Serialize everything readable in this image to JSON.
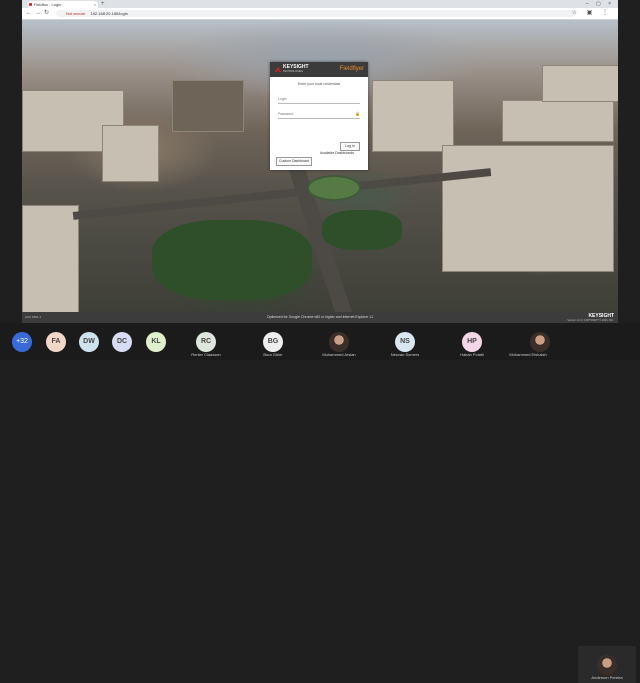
{
  "browser": {
    "tab_title": "Fieldfox - Login",
    "tab_close": "×",
    "new_tab": "+",
    "window_controls": "–  ▢  ×",
    "nav": {
      "back": "←",
      "forward": "→",
      "reload": "↻"
    },
    "security": "Not secure",
    "url": "192.168.20.185/login",
    "toolbar_icons": "☆ ▣ ⋮"
  },
  "login_card": {
    "brand": "KEYSIGHT",
    "brand_sub": "TECHNOLOGIES",
    "product": "Fieldflyer",
    "prompt": "Enter your local credentials",
    "login_placeholder": "Login",
    "password_placeholder": "Password",
    "login_button": "Log in",
    "available_dashboards": "Available Dashboards",
    "custom_dashboard_button": "Custom Dashboard"
  },
  "footer": {
    "left_text": "AUX 6891.1",
    "notice": "Optimized for Google Chrome v80 or higher and Internet Explorer 11",
    "brand": "KEYSIGHT",
    "copyright": "Version 1.0.1 | COPYRIGHT © 2021, INC."
  },
  "participants": {
    "more_count": "+32",
    "people": [
      {
        "initials": "FA",
        "name": "",
        "color": "#f2d7c8"
      },
      {
        "initials": "DW",
        "name": "",
        "color": "#cfe3ef"
      },
      {
        "initials": "DC",
        "name": "",
        "color": "#d8dcf3"
      },
      {
        "initials": "KL",
        "name": "",
        "color": "#dff0cf"
      },
      {
        "initials": "RC",
        "name": "Renier Claassen",
        "color": "#dfe6dd"
      },
      {
        "initials": "BG",
        "name": "Bora Güler",
        "color": "#eeeeee"
      },
      {
        "initials": "",
        "name": "Muhammed Arslan",
        "color": ""
      },
      {
        "initials": "NS",
        "name": "Nesvan Somers",
        "color": "#d9e7f3"
      },
      {
        "initials": "HP",
        "name": "Hakan Polatli",
        "color": "#f4d6e8"
      },
      {
        "initials": "",
        "name": "Muhammed Elshaish",
        "color": ""
      },
      {
        "initials": "",
        "name": "Anderson Pereira",
        "color": ""
      }
    ]
  }
}
